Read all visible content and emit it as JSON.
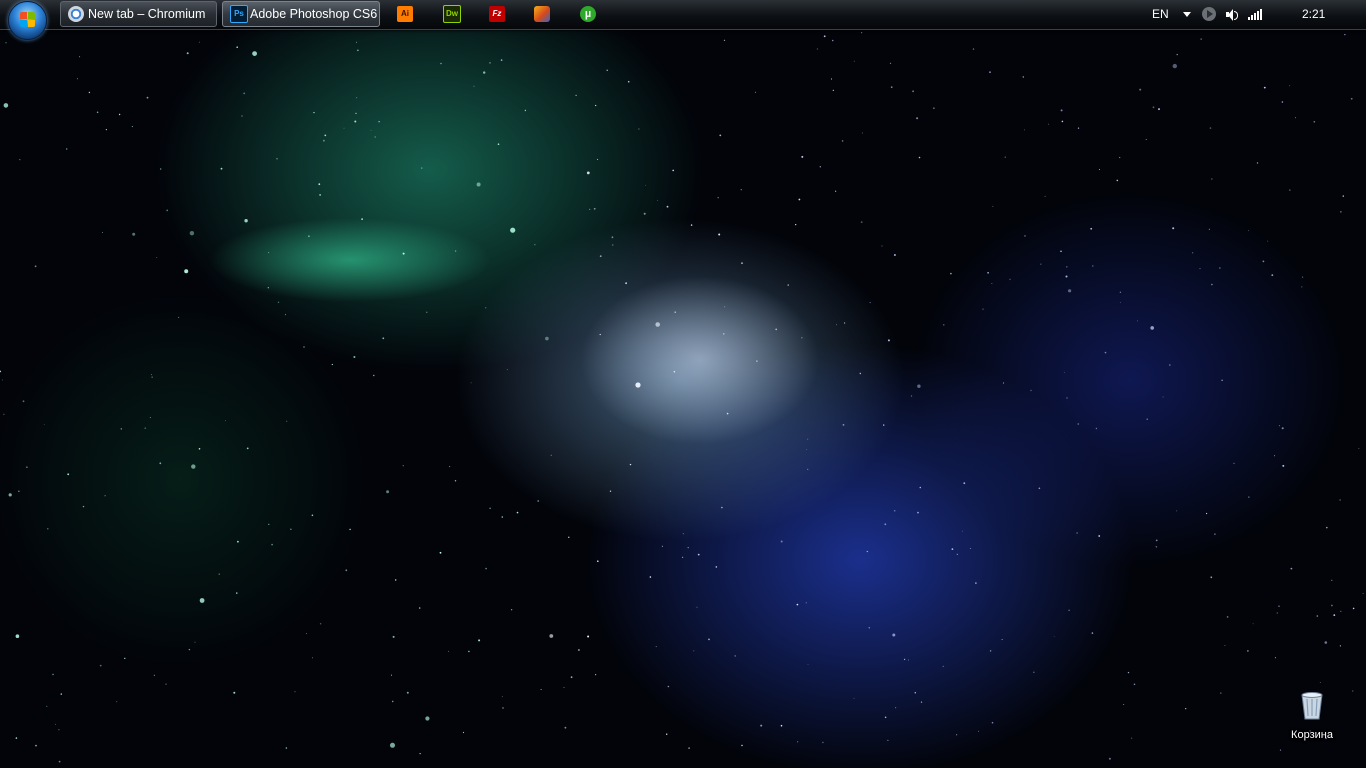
{
  "taskbar": {
    "start_button": "start-orb-icon",
    "windows": [
      {
        "label": "New tab – Chromium",
        "icon": "chromium-icon",
        "active": false
      },
      {
        "label": "Adobe Photoshop CS6",
        "icon": "photoshop-icon",
        "icon_text": "Ps",
        "active": true
      }
    ],
    "quick_launch": [
      {
        "name": "illustrator-icon",
        "text": "Ai",
        "bg": "#ff7c00",
        "fg": "#3a1400"
      },
      {
        "name": "dreamweaver-icon",
        "text": "Dw",
        "bg": "#1b2b05",
        "fg": "#8fd400"
      },
      {
        "name": "filezilla-icon",
        "text": "Fz",
        "bg": "#bf0000",
        "fg": "#ffffff"
      },
      {
        "name": "app-icon",
        "text": "",
        "bg": "#d54a1c",
        "fg": "#ffffff"
      },
      {
        "name": "utorrent-icon",
        "text": "µ",
        "bg": "#2fa92b",
        "fg": "#ffffff"
      }
    ],
    "tray": {
      "language": "EN",
      "time": "2:21"
    }
  },
  "desktop": {
    "icons": [
      {
        "label": "Корзина",
        "icon": "recycle-bin-icon"
      }
    ]
  },
  "colors": {
    "photoshop": "#001e36",
    "photoshop_text": "#31a8ff"
  }
}
